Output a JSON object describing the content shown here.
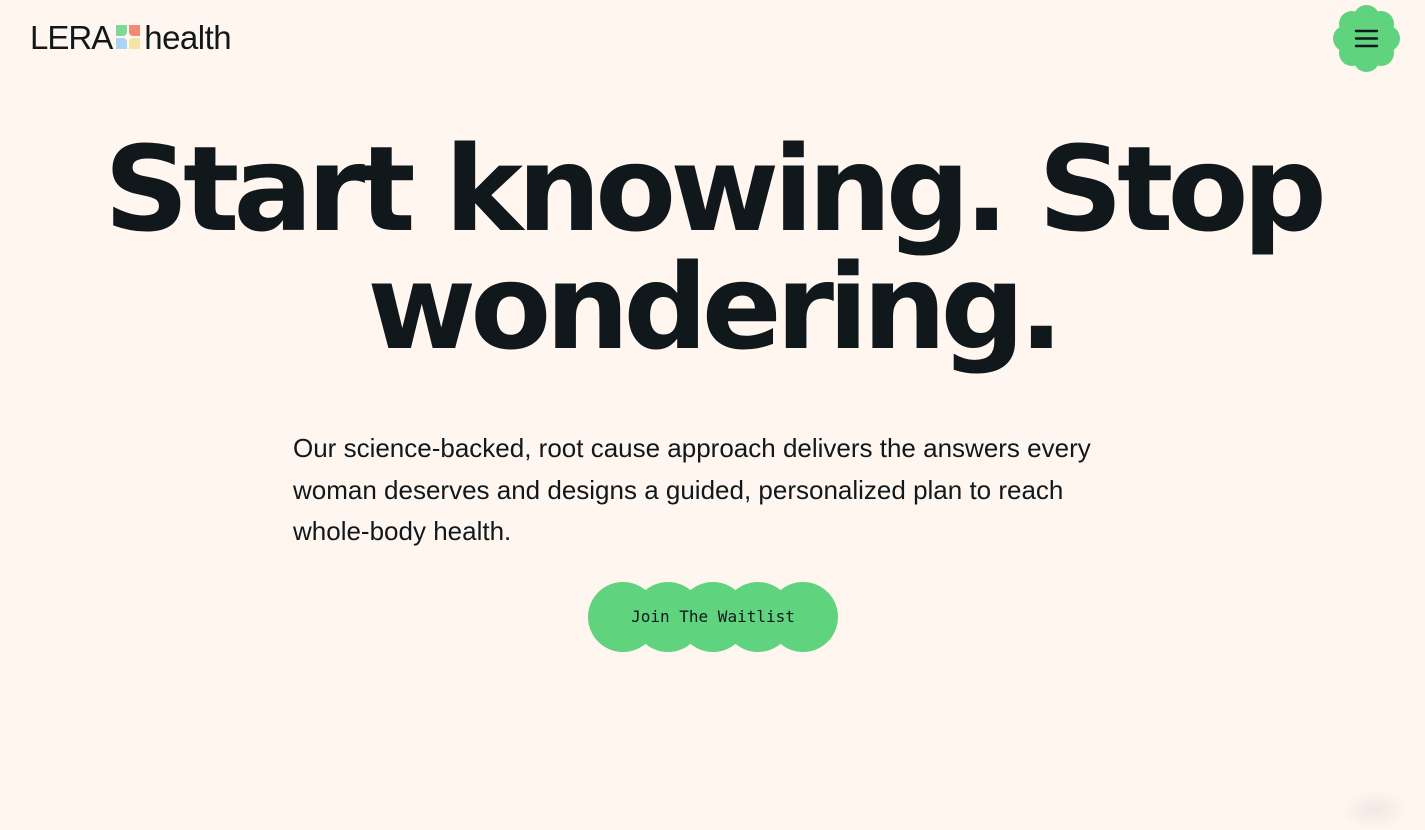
{
  "header": {
    "logo_text_left": "LERA",
    "logo_text_right": "health",
    "menu_icon": "hamburger-menu-icon"
  },
  "hero": {
    "headline": "Start knowing. Stop wondering.",
    "description": "Our science-backed, root cause approach delivers the answers every woman deserves and designs a guided, personalized plan to reach whole-body health.",
    "cta_label": "Join The Waitlist"
  },
  "colors": {
    "background": "#FFF6F0",
    "text": "#11181C",
    "accent_green": "#5FD37E",
    "logo_coral": "#F28A78",
    "logo_green": "#7ED89A",
    "logo_blue": "#A9D4F2",
    "logo_yellow": "#F4E3A4"
  }
}
